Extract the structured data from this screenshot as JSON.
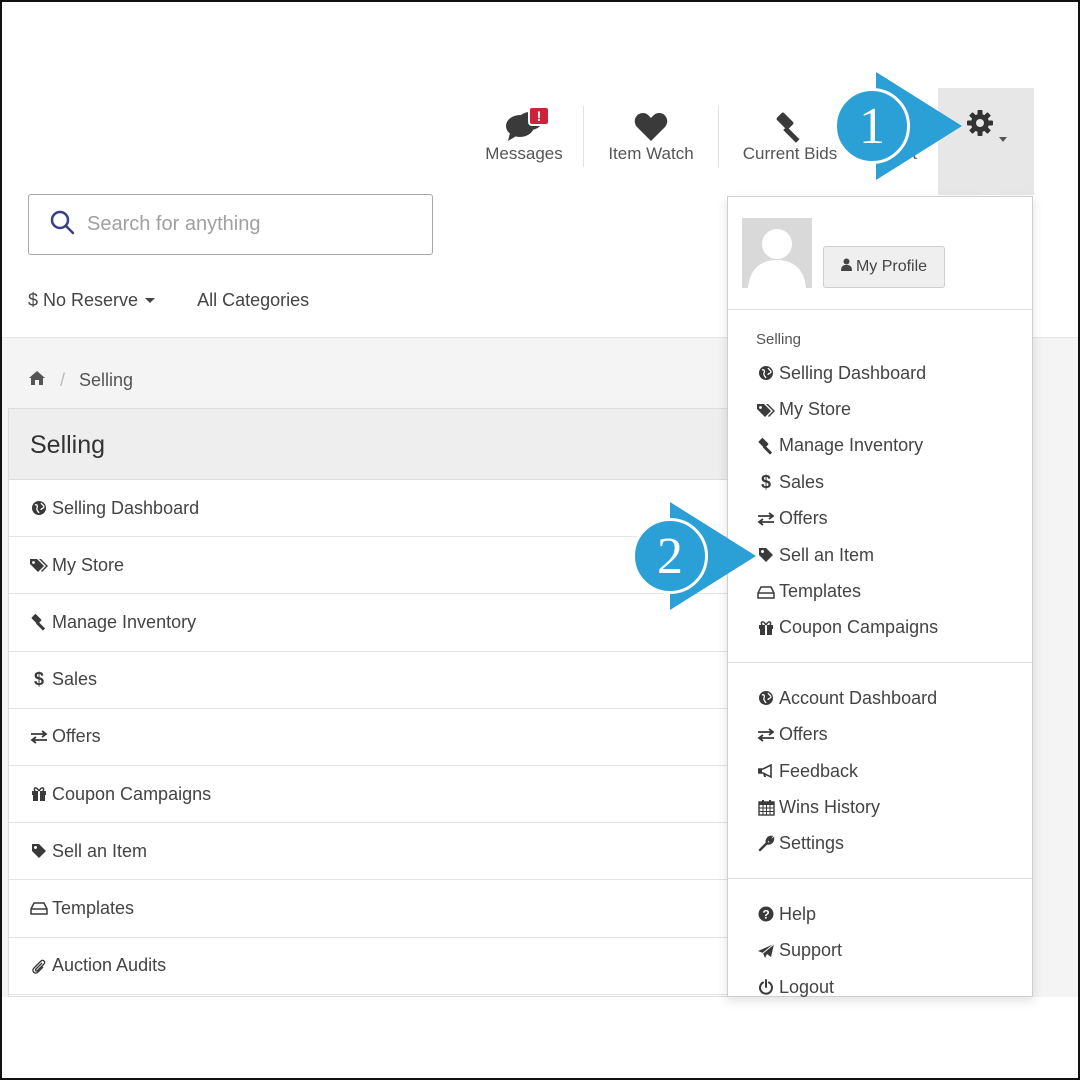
{
  "nav": {
    "messages": "Messages",
    "messages_badge": "!",
    "item_watch": "Item Watch",
    "current_bids": "Current Bids",
    "cart": "Cart"
  },
  "search": {
    "placeholder": "Search for anything"
  },
  "filters": {
    "no_reserve": "$ No Reserve",
    "categories": "All Categories"
  },
  "breadcrumb": {
    "current": "Selling",
    "separator": "/"
  },
  "panel": {
    "title": "Selling",
    "rows": [
      {
        "icon": "globe-icon",
        "label": "Selling Dashboard"
      },
      {
        "icon": "tags-icon",
        "label": "My Store"
      },
      {
        "icon": "gavel-icon",
        "label": "Manage Inventory"
      },
      {
        "icon": "dollar-icon",
        "label": "Sales"
      },
      {
        "icon": "exchange-icon",
        "label": "Offers"
      },
      {
        "icon": "gift-icon",
        "label": "Coupon Campaigns"
      },
      {
        "icon": "tag-icon",
        "label": "Sell an Item"
      },
      {
        "icon": "hdd-icon",
        "label": "Templates"
      },
      {
        "icon": "paperclip-icon",
        "label": "Auction Audits"
      }
    ]
  },
  "dropdown": {
    "profile_button": "My Profile",
    "selling_heading": "Selling",
    "selling": [
      {
        "icon": "globe-icon",
        "label": "Selling Dashboard"
      },
      {
        "icon": "tags-icon",
        "label": "My Store"
      },
      {
        "icon": "gavel-icon",
        "label": "Manage Inventory"
      },
      {
        "icon": "dollar-icon",
        "label": "Sales"
      },
      {
        "icon": "exchange-icon",
        "label": "Offers"
      },
      {
        "icon": "tag-icon",
        "label": "Sell an Item"
      },
      {
        "icon": "hdd-icon",
        "label": "Templates"
      },
      {
        "icon": "gift-icon",
        "label": "Coupon Campaigns"
      }
    ],
    "account": [
      {
        "icon": "globe-icon",
        "label": "Account Dashboard"
      },
      {
        "icon": "exchange-icon",
        "label": "Offers"
      },
      {
        "icon": "bullhorn-icon",
        "label": "Feedback"
      },
      {
        "icon": "calendar-icon",
        "label": "Wins History"
      },
      {
        "icon": "wrench-icon",
        "label": "Settings"
      }
    ],
    "help": [
      {
        "icon": "question-icon",
        "label": "Help"
      },
      {
        "icon": "paper-plane-icon",
        "label": "Support"
      },
      {
        "icon": "power-icon",
        "label": "Logout"
      }
    ]
  },
  "callouts": {
    "step1": "1",
    "step2": "2"
  },
  "colors": {
    "callout": "#2aa0d6",
    "badge": "#d0213a",
    "gear_bg": "#e7e7e7"
  }
}
